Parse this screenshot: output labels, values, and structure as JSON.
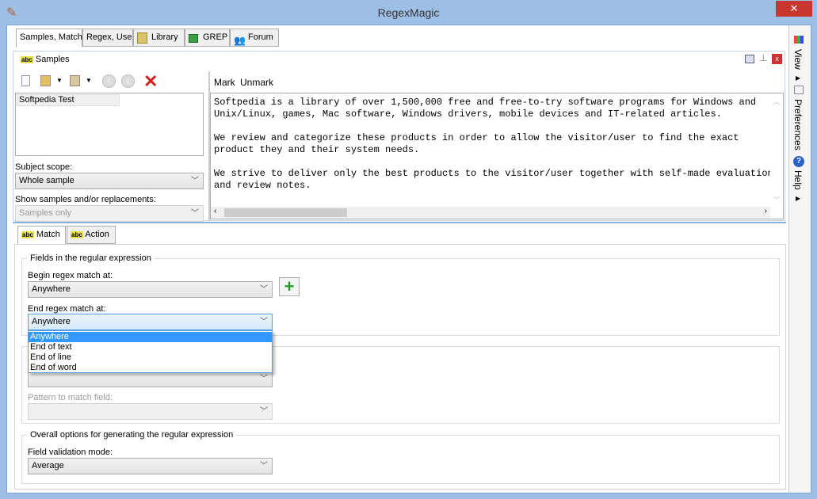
{
  "window": {
    "title": "RegexMagic",
    "close": "✕"
  },
  "tabs": [
    {
      "label": "Samples, Match"
    },
    {
      "label": "Regex, Use"
    },
    {
      "label": "Library"
    },
    {
      "label": "GREP"
    },
    {
      "label": "Forum"
    }
  ],
  "samples": {
    "title": "Samples",
    "items": [
      "Softpedia Test"
    ],
    "mark": "Mark",
    "unmark": "Unmark",
    "subject_scope_label": "Subject scope:",
    "subject_scope_value": "Whole sample",
    "show_label": "Show samples and/or replacements:",
    "show_value": "Samples only",
    "text": "Softpedia is a library of over 1,500,000 free and free-to-try software programs for Windows and\nUnix/Linux, games, Mac software, Windows drivers, mobile devices and IT-related articles.\n\nWe review and categorize these products in order to allow the visitor/user to find the exact\nproduct they and their system needs.\n\nWe strive to deliver only the best products to the visitor/user together with self-made evaluation\nand review notes."
  },
  "subtabs": [
    {
      "label": "Match"
    },
    {
      "label": "Action"
    }
  ],
  "fields": {
    "group_title": "Fields in the regular expression",
    "begin_label": "Begin regex match at:",
    "begin_value": "Anywhere",
    "end_label": "End regex match at:",
    "end_value": "Anywhere",
    "end_options": [
      "Anywhere",
      "End of text",
      "End of line",
      "End of word"
    ],
    "pattern_label": "Pattern to match field:"
  },
  "overall": {
    "group_title": "Overall options for generating the regular expression",
    "validation_label": "Field validation mode:",
    "validation_value": "Average"
  },
  "sidebar": {
    "view": "View",
    "preferences": "Preferences",
    "help": "Help"
  }
}
